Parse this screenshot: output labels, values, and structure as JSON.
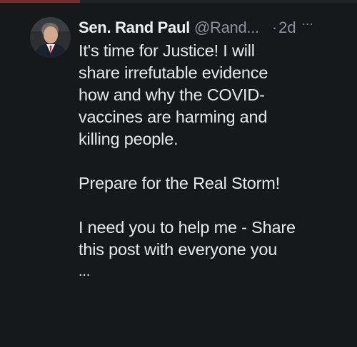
{
  "tweet": {
    "author_name": "Sen. Rand Paul",
    "handle": "@Rand...",
    "separator": "·",
    "time": "2d",
    "more_icon": "more-horizontal-icon",
    "paragraphs": [
      [
        "It's time for Justice! I will",
        "share irrefutable evidence",
        "how and why the COVID-",
        "vaccines are harming and",
        "killing people."
      ],
      [
        "Prepare for the Real Storm!"
      ],
      [
        "I need you to help me - Share",
        "this post with everyone you"
      ]
    ],
    "truncation": "..."
  },
  "colors": {
    "background": "#16181c",
    "text": "#e7e9ea",
    "muted": "#8b9199"
  }
}
